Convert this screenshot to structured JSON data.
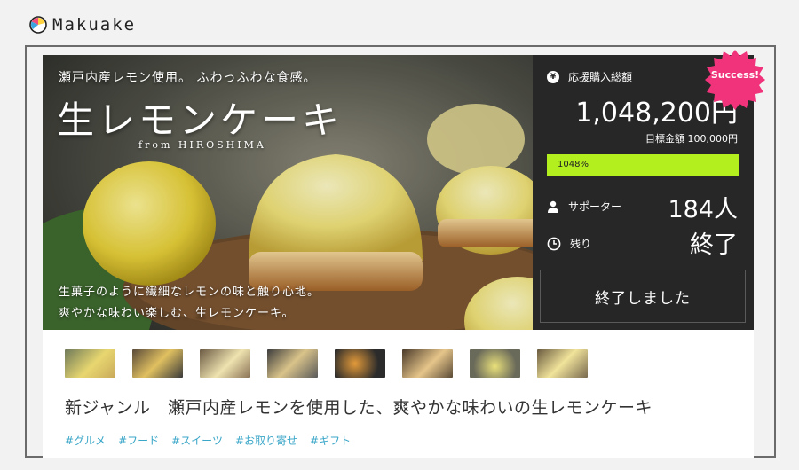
{
  "brand": {
    "name": "Makuake"
  },
  "hero": {
    "subtitle": "瀬戸内産レモン使用。 ふわっふわな食感。",
    "title": "生レモンケーキ",
    "from": "from  HIROSHIMA",
    "caption_line1": "生菓子のように繊細なレモンの味と触り心地。",
    "caption_line2": "爽やかな味わい楽しむ、生レモンケーキ。"
  },
  "panel": {
    "amount_label": "応援購入総額",
    "amount": "1,048,200円",
    "goal": "目標金額 100,000円",
    "progress_text": "1048%",
    "progress_fraction": 1.0,
    "supporters_label": "サポーター",
    "supporters": "184人",
    "remaining_label": "残り",
    "remaining": "終了",
    "ended_button": "終了しました",
    "badge": "Success!",
    "yen_icon_glyph": "¥"
  },
  "colors": {
    "panel_bg": "#272727",
    "progress": "#b3ef1e",
    "badge": "#f0337a",
    "tag": "#3aa6c8"
  },
  "thumbnails": [
    "cake-lemons",
    "hands-lemon",
    "cake-cream",
    "oven-tray",
    "baking-cups",
    "cakes-tray",
    "lemon-bowl",
    "cakes-rows"
  ],
  "project": {
    "title": "新ジャンル　瀬戸内産レモンを使用した、爽やかな味わいの生レモンケーキ",
    "tags": [
      "#グルメ",
      "#フード",
      "#スイーツ",
      "#お取り寄せ",
      "#ギフト"
    ]
  }
}
